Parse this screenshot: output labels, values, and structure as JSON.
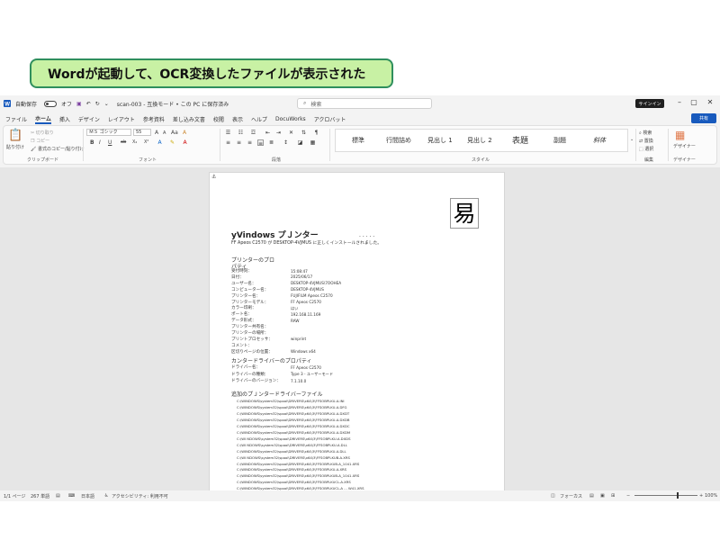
{
  "caption": "Wordが起動して、OCR変換したファイルが表示された",
  "titlebar": {
    "autosave_label": "自動保存",
    "autosave_state": "オフ",
    "doc_name": "scan-003 - 互換モード • この PC に保存済み",
    "search_placeholder": "検索",
    "signin_label": "サインイン"
  },
  "menubar": {
    "tabs": [
      "ファイル",
      "ホーム",
      "挿入",
      "デザイン",
      "レイアウト",
      "参考資料",
      "差し込み文書",
      "校閲",
      "表示",
      "ヘルプ",
      "DocuWorks",
      "アクロバット"
    ],
    "share_label": "共有"
  },
  "ribbon": {
    "clipboard": {
      "label": "クリップボード",
      "paste": "貼り付け",
      "cut": "切り取り",
      "copy": "コピー",
      "format_painter": "書式のコピー/貼り付け"
    },
    "font": {
      "label": "フォント",
      "font_name": "ＭＳ ゴシック",
      "font_size": "55",
      "font_size_grow": "A",
      "font_size_shrink": "A",
      "aa": "Aa",
      "clear_format": "A",
      "b": "B",
      "i": "I",
      "u": "U",
      "strike": "ab",
      "sub": "X₂",
      "sup": "X²"
    },
    "paragraph": {
      "label": "段落"
    },
    "styles": {
      "label": "スタイル",
      "items": [
        "標準",
        "行間詰め",
        "見出し 1",
        "見出し 2",
        "表題",
        "副題",
        "斜体"
      ]
    },
    "editing": {
      "label": "編集",
      "find": "検索",
      "replace": "置換",
      "select": "選択"
    },
    "designer": {
      "label": "デザイナー",
      "button": "デザイナー"
    }
  },
  "document": {
    "ocr_glyph": "易",
    "title": "yVindows プＪンター　　　",
    "title_dots": ". . . . .",
    "line1": "FF Apeos C2570 が DESKTOP-4VJMUS に正しくインストールされました。",
    "props_heading": "プリンターのプロ",
    "props_heading2": "パティ",
    "props": [
      {
        "k": "受付時刻：",
        "v": "15:08:47"
      },
      {
        "k": "日付：",
        "v": "2025/06/17"
      },
      {
        "k": "ユーザー名：",
        "v": "DESKTOP-4VJMUS\\7OOHEA"
      },
      {
        "k": "コンピューター名：",
        "v": "DESKTOP-4VJMUS"
      },
      {
        "k": "プリンター名：",
        "v": "FUJIFILM Apeos C2570"
      },
      {
        "k": "プリンターモデル：",
        "v": "FF Apeos C2570"
      },
      {
        "k": "カラー印刷：",
        "v": "はい"
      },
      {
        "k": "ポート名：",
        "v": "192.168.11.169"
      },
      {
        "k": "データ形式：",
        "v": "RAW"
      },
      {
        "k": "プリンター共有名：",
        "v": ""
      },
      {
        "k": "プリンターの場所：",
        "v": ""
      },
      {
        "k": "プリントプロセッサ：",
        "v": "winprint"
      },
      {
        "k": "コメント：",
        "v": ""
      },
      {
        "k": "区切りページの位置：",
        "v": "Windows x64"
      }
    ],
    "driver_heading": "カンタードライバーのプロパティ",
    "driver": [
      {
        "k": "ドライバー名：",
        "v": "FF Apeos C2570"
      },
      {
        "k": "ドライバーの種類：",
        "v": "Type 3 - ユーザーモード"
      },
      {
        "k": "ドライバーのバージョン：",
        "v": "7.1.10.0"
      }
    ],
    "files_heading": "追加のプＪンタードライバーファイル",
    "files": [
      "C:\\WINDOWS\\system32\\spool\\DRIVERS\\x64\\3\\FFSOBPLKU-A.INI",
      "C:\\WINDOWS\\system32\\spool\\DRIVERS\\x64\\3\\FFSOBPLKU-A.DFG",
      "C:\\WINDOWS\\system32\\spool\\DRIVERS\\x64\\3\\FFSOBPLKU-A.DXDT",
      "C:\\WINDOWS\\system32\\spool\\DRIVERS\\x64\\3\\FFSOBPLKU-A.DXDB",
      "C:\\WINDOWS\\system32\\spool\\DRIVERS\\x64\\3\\FFSOBPLKU-A.DXDC",
      "C:\\WINDOWS\\system32\\spool\\DRIVERS\\x64\\3\\FFSOBPLKU-A.DXDM",
      "C:\\WI NDOWS\\system32\\spool\\DRIVERS\\x64\\3\\FFSOBPLKU-A.DXDS",
      "C:\\WI NDOWS\\system32\\spool\\DRIVERS\\x64\\3\\FFSOBPLKU-A.DLL",
      "C:\\WINDOWS\\system32\\spool\\DRIVERS\\x64\\3\\FFSOBPLKU-A.DLL",
      "C:\\WI NDOWS\\system32\\spool\\DRIVERS\\x64\\3\\FFSOBPLKUB-A.XRS",
      "C:\\WINDOWS\\system32\\spool\\DRIVERS\\x64\\3\\FFSOBPLKUB-A_1041.XRS",
      "C:\\WINDOWS\\system32\\spool\\DRIVERS\\x64\\3\\FFSOBPLKU-A.XRS",
      "C:\\WINDOWS\\system32\\spool\\DRIVERS\\x64\\3\\FFSOBPLKUB-A_1041.XRS",
      "C:\\WINDOWS\\system32\\spool\\DRIVERS\\x64\\3\\FFSOBPLKUCL-A.XRS",
      "C:\\WINDOWS\\system32\\spool\\DRIVERS\\x64\\3\\FFSOBPLKUCL-A ... W41.XRS",
      "C:\\WINDOWS\\system32\\spool\\DRIVERS\\x64\\3\\FFSOBPLKUC ... A.XRS"
    ]
  },
  "statusbar": {
    "page": "1/1 ページ",
    "words": "267 単語",
    "lang": "日本語",
    "accessibility": "アクセシビリティ: 利用不可",
    "focus": "フォーカス",
    "zoom_minus": "−",
    "zoom_plus": "+",
    "zoom": "100%"
  }
}
